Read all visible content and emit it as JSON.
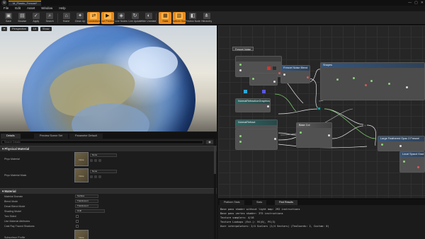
{
  "window": {
    "tab_title": "M_Plastic_Fresnel*",
    "controls": [
      "—",
      "▢",
      "✕"
    ]
  },
  "menu": [
    "File",
    "Edit",
    "Asset",
    "Window",
    "Help"
  ],
  "toolbar": [
    {
      "label": "Save",
      "icon": "save-icon",
      "glyph": "▣",
      "active": false
    },
    {
      "label": "Browse",
      "icon": "browse-icon",
      "glyph": "▤",
      "active": false
    },
    {
      "label": "Apply",
      "icon": "apply-icon",
      "glyph": "✓",
      "active": false
    },
    {
      "label": "Search",
      "icon": "search-icon",
      "glyph": "⌕",
      "active": false
    },
    {
      "label": "Home",
      "icon": "home-icon",
      "glyph": "⌂",
      "active": false
    },
    {
      "label": "Clean Up",
      "icon": "cleanup-icon",
      "glyph": "✦",
      "active": false
    },
    {
      "label": "Connectors",
      "icon": "connectors-icon",
      "glyph": "⇄",
      "active": true
    },
    {
      "label": "Live Preview",
      "icon": "live-preview-icon",
      "glyph": "▶",
      "active": true
    },
    {
      "label": "Live Nodes",
      "icon": "live-nodes-icon",
      "glyph": "◈",
      "active": false
    },
    {
      "label": "Live Update",
      "icon": "live-update-icon",
      "glyph": "↻",
      "active": false
    },
    {
      "label": "Hide Unrelated",
      "icon": "hide-unrelated-icon",
      "glyph": "◐",
      "active": false
    },
    {
      "label": "Stats",
      "icon": "stats-icon",
      "glyph": "▦",
      "active": true
    },
    {
      "label": "Platform Stats",
      "icon": "platform-stats-icon",
      "glyph": "▥",
      "active": true
    },
    {
      "label": "Preview Nodes",
      "icon": "preview-nodes-icon",
      "glyph": "◧",
      "active": false
    },
    {
      "label": "Hierarchy",
      "icon": "hierarchy-icon",
      "glyph": "⋔",
      "active": false
    }
  ],
  "viewport": {
    "buttons": [
      "Perspective",
      "Lit",
      "Show"
    ]
  },
  "details": {
    "tabs": [
      "Details",
      "Preview Scene Set",
      "Parameter Default"
    ],
    "search_placeholder": "Search Details",
    "physical_material": {
      "header": "Physical Material",
      "rows": [
        {
          "label": "Phys Material",
          "value": "None",
          "thumb": "None"
        },
        {
          "label": "Phys Material Mask",
          "value": "None",
          "thumb": "None"
        }
      ]
    },
    "material": {
      "header": "Material",
      "rows": [
        {
          "label": "Material Domain",
          "value": "Surface",
          "kind": "dropdown"
        },
        {
          "label": "Blend Mode",
          "value": "Translucent",
          "kind": "dropdown"
        },
        {
          "label": "Decal Blend Mode",
          "value": "Translucent",
          "kind": "dropdown"
        },
        {
          "label": "Shading Model",
          "value": "Unlit",
          "kind": "dropdown"
        },
        {
          "label": "Two Sided",
          "value": "",
          "kind": "check"
        },
        {
          "label": "Use Material Attributes",
          "value": "",
          "kind": "check"
        },
        {
          "label": "Cast Ray Traced Shadows",
          "value": "",
          "kind": "check"
        }
      ],
      "subsurface": {
        "label": "Subsurface Profile",
        "thumb": "None"
      }
    }
  },
  "graph": {
    "nodes": [
      {
        "title": "Fresnel Noise",
        "color": "blue"
      },
      {
        "title": "Fresnel Noise Blend",
        "color": "blue"
      },
      {
        "title": "Shapes",
        "color": "blue"
      },
      {
        "title": "NormalRefractionGraphics",
        "color": "teal"
      },
      {
        "title": "NormalRefract",
        "color": "teal"
      },
      {
        "title": "Base Col",
        "color": "gray"
      },
      {
        "title": "Large Feathered Opac 2 Fresnel",
        "color": "blue"
      },
      {
        "title": "Local Spacd Grad",
        "color": "blue"
      }
    ]
  },
  "stats": {
    "tabs": [
      "Platform Stats",
      "Stats",
      "Find Results"
    ],
    "lines": [
      "Base pass shader without light map: 292 instructions",
      "Base pass vertex shader: 375 instructions",
      "Texture samplers: 4/16",
      "Texture Lookups (Est.): VS(0), PS(3)",
      "User interpolators: 2/4 Scalars (1/4 Vectors) (TexCoords: 2, Custom: 0)"
    ]
  },
  "colors": {
    "accent": "#e88b1e",
    "graph_bg": "#262626",
    "panel_bg": "#1c1c1c"
  }
}
